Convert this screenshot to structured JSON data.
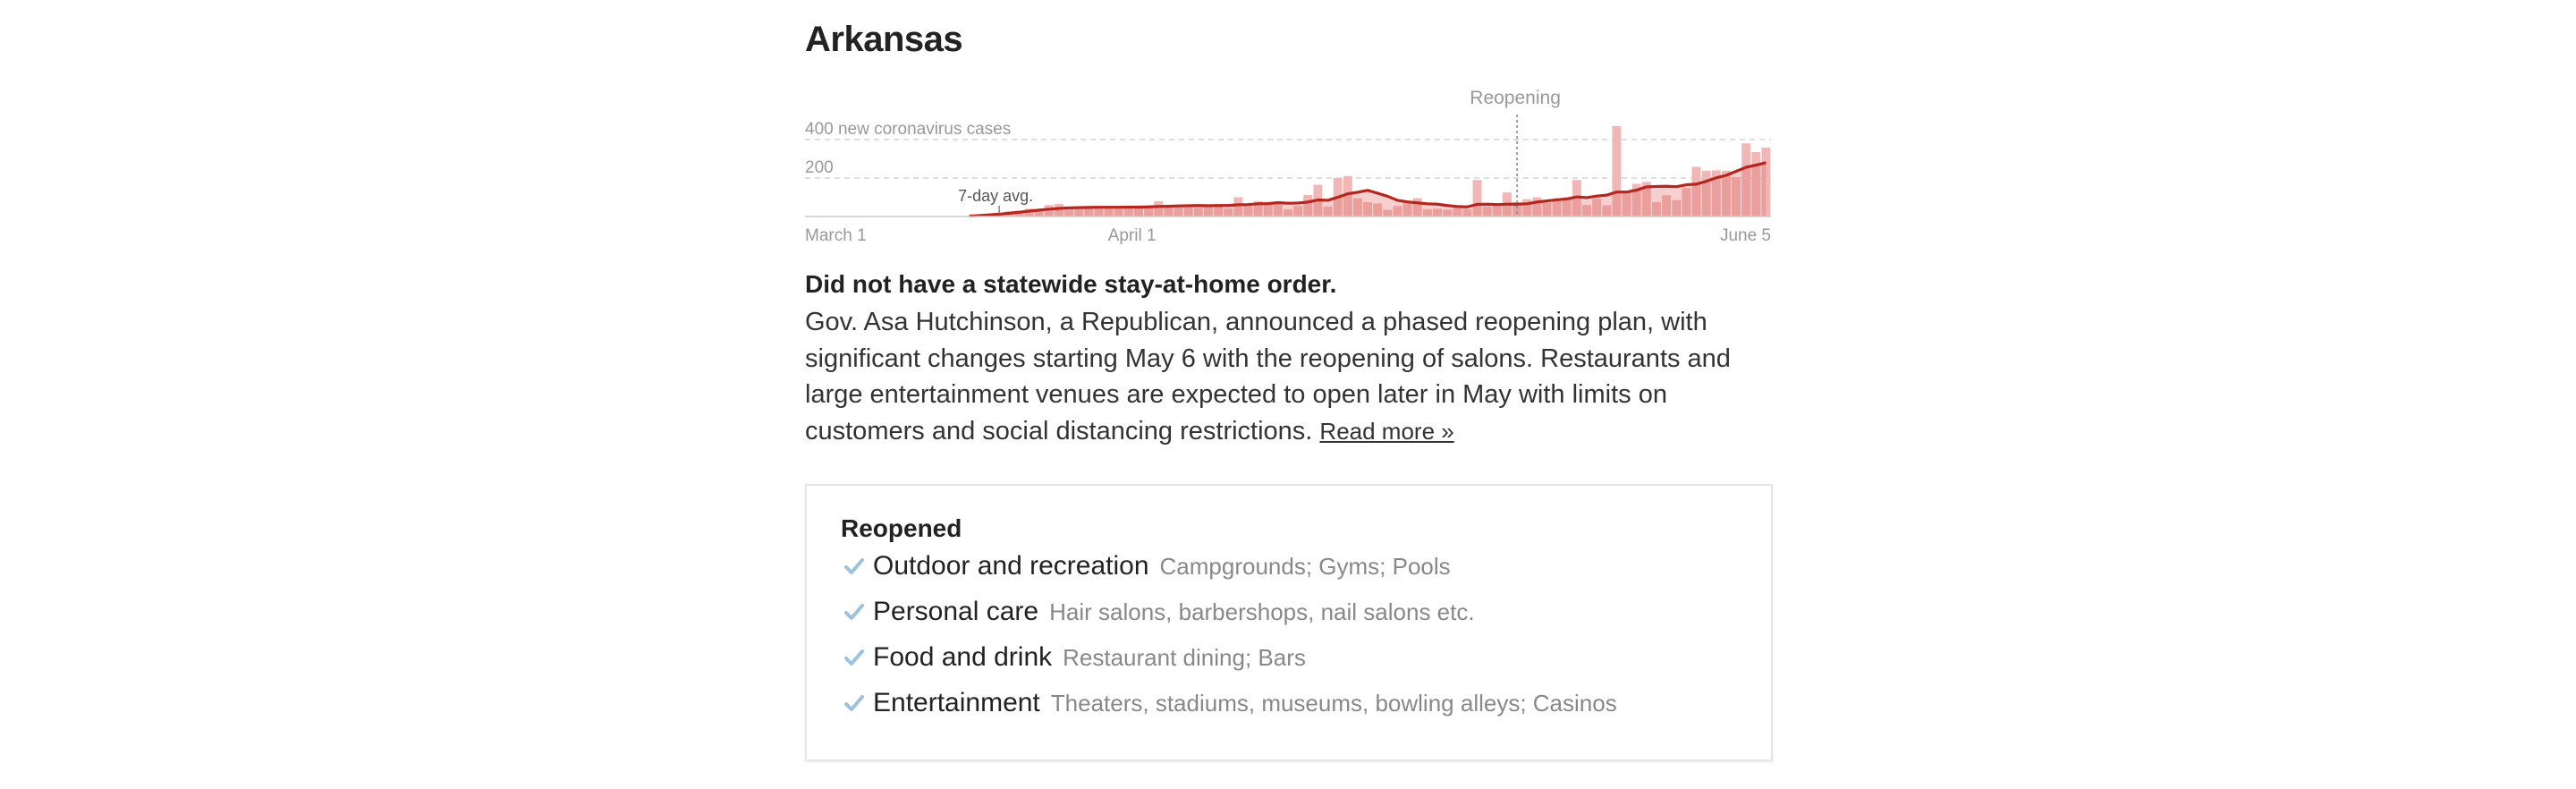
{
  "state": {
    "title": "Arkansas"
  },
  "chart_data": {
    "type": "bar",
    "title": "",
    "ylabel": "new coronavirus cases",
    "ylim": [
      0,
      400
    ],
    "yticks": [
      {
        "value": 400,
        "label": "400 new coronavirus cases"
      },
      {
        "value": 200,
        "label": "200"
      }
    ],
    "xlim": [
      "2020-03-01",
      "2020-06-05"
    ],
    "xticks": [
      {
        "value": "2020-03-01",
        "label": "March 1"
      },
      {
        "value": "2020-04-01",
        "label": "April 1"
      },
      {
        "value": "2020-06-05",
        "label": "June 5"
      }
    ],
    "annotations": [
      {
        "type": "vline",
        "x": "2020-05-11",
        "label": "Reopening"
      },
      {
        "type": "series-label",
        "x": "2020-03-20",
        "label": "7-day avg."
      }
    ],
    "start_date": "2020-03-01",
    "daily_cases": [
      0,
      0,
      0,
      0,
      0,
      0,
      0,
      0,
      0,
      0,
      0,
      0,
      0,
      0,
      0,
      0,
      3,
      6,
      12,
      18,
      26,
      30,
      40,
      32,
      60,
      65,
      50,
      38,
      40,
      45,
      42,
      40,
      43,
      44,
      50,
      80,
      55,
      62,
      60,
      45,
      50,
      60,
      42,
      100,
      55,
      80,
      60,
      70,
      38,
      55,
      112,
      165,
      52,
      200,
      210,
      95,
      75,
      68,
      35,
      55,
      75,
      95,
      38,
      40,
      35,
      45,
      38,
      190,
      52,
      68,
      125,
      74,
      90,
      100,
      72,
      84,
      100,
      190,
      60,
      92,
      58,
      470,
      135,
      170,
      180,
      75,
      110,
      85,
      148,
      258,
      238,
      240,
      238,
      205,
      380,
      335,
      358
    ],
    "avg_7day": [
      null,
      null,
      null,
      null,
      null,
      null,
      null,
      null,
      null,
      null,
      null,
      null,
      null,
      null,
      null,
      null,
      2,
      5,
      8,
      12,
      17,
      22,
      28,
      33,
      38,
      42,
      45,
      46,
      47,
      48,
      48,
      48,
      49,
      49,
      50,
      52,
      53,
      55,
      56,
      57,
      56,
      57,
      57,
      61,
      62,
      66,
      67,
      72,
      69,
      70,
      75,
      86,
      84,
      100,
      118,
      126,
      136,
      121,
      105,
      84,
      76,
      71,
      66,
      64,
      57,
      52,
      50,
      63,
      64,
      62,
      64,
      64,
      66,
      75,
      81,
      87,
      91,
      102,
      98,
      106,
      111,
      127,
      127,
      137,
      154,
      156,
      157,
      155,
      165,
      168,
      183,
      201,
      214,
      235,
      256,
      267,
      280
    ],
    "bar_color": "#f1b7b6",
    "line_color": "#b4261e",
    "grid": "dashed"
  },
  "status": {
    "heading": "Did not have a statewide stay-at-home order.",
    "body": "Gov. Asa Hutchinson, a Republican, announced a phased reopening plan, with significant changes starting May 6 with the reopening of salons. Restaurants and large entertainment venues are expected to open later in May with limits on customers and social distancing restrictions. ",
    "link": "Read more »"
  },
  "reopened": {
    "heading": "Reopened",
    "check_icon": "checkmark-icon",
    "check_color": "#9dc2dd",
    "items": [
      {
        "category": "Outdoor and recreation",
        "details": "Campgrounds; Gyms; Pools"
      },
      {
        "category": "Personal care",
        "details": "Hair salons, barbershops, nail salons etc."
      },
      {
        "category": "Food and drink",
        "details": "Restaurant dining; Bars"
      },
      {
        "category": "Entertainment",
        "details": "Theaters, stadiums, museums, bowling alleys; Casinos"
      }
    ]
  }
}
